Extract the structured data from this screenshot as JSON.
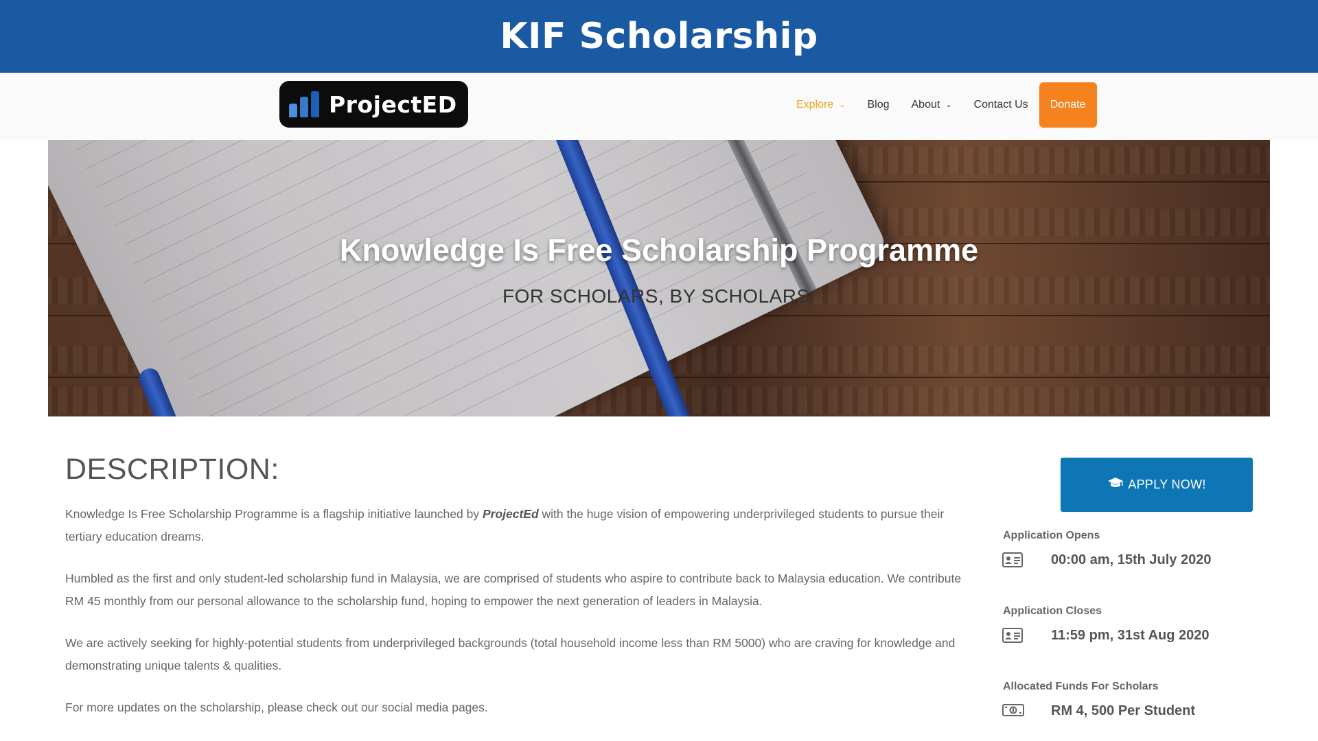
{
  "banner": {
    "title": "KIF Scholarship"
  },
  "header": {
    "logo_text": "ProjectED",
    "nav": [
      {
        "label": "Explore",
        "has_dropdown": true,
        "active": true
      },
      {
        "label": "Blog",
        "has_dropdown": false,
        "active": false
      },
      {
        "label": "About",
        "has_dropdown": true,
        "active": false
      },
      {
        "label": "Contact Us",
        "has_dropdown": false,
        "active": false
      }
    ],
    "donate_label": "Donate"
  },
  "hero": {
    "title": "Knowledge Is Free Scholarship Programme",
    "subtitle": "FOR SCHOLARS, BY SCHOLARS."
  },
  "main": {
    "heading": "DESCRIPTION:",
    "para1_before": "Knowledge Is Free Scholarship Programme is a flagship initiative launched by ",
    "para1_brand": "ProjectEd",
    "para1_after": " with the huge vision of empowering underprivileged students to pursue their tertiary education dreams.",
    "para2": "Humbled as the first and only student-led scholarship fund in Malaysia, we are comprised of students who aspire to contribute back to Malaysia education. We contribute RM 45 monthly from our personal allowance to the scholarship fund, hoping to empower the next generation of leaders in Malaysia.",
    "para3": "We are actively seeking for highly-potential students from underprivileged backgrounds (total household income less than RM 5000) who are craving for knowledge and demonstrating unique talents & qualities.",
    "para4": "For more updates on the scholarship, please check out our social media pages."
  },
  "sidebar": {
    "apply_label": "APPLY NOW!",
    "info": [
      {
        "label": "Application Opens",
        "value": "00:00 am, 15th July 2020",
        "icon": "id-card-icon"
      },
      {
        "label": "Application Closes",
        "value": "11:59 pm, 31st Aug 2020",
        "icon": "id-card-icon"
      },
      {
        "label": "Allocated Funds For Scholars",
        "value": "RM 4, 500 Per Student",
        "icon": "money-bill-icon"
      }
    ]
  },
  "colors": {
    "banner": "#1a5aa3",
    "nav_active": "#f0a21a",
    "donate": "#f5821f",
    "apply": "#0f76b5"
  }
}
